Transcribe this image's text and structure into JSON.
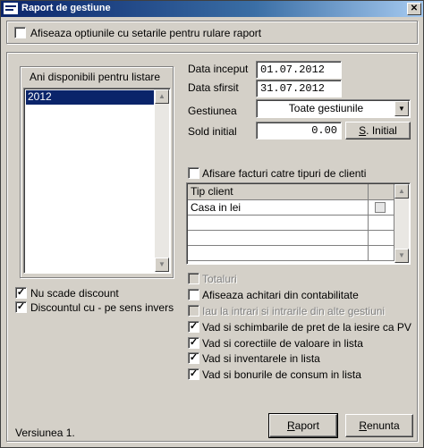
{
  "window": {
    "title": "Raport de gestiune",
    "close_glyph": "✕"
  },
  "top_option": {
    "label": "Afiseaza optiunile cu setarile pentru rulare raport",
    "checked": false
  },
  "years_panel": {
    "header": "Ani disponibili pentru listare",
    "items": [
      "2012"
    ],
    "selected": "2012"
  },
  "left_options": [
    {
      "label": "Nu scade discount",
      "checked": true
    },
    {
      "label": "Discountul cu - pe sens invers",
      "checked": true
    }
  ],
  "form": {
    "start_label": "Data inceput",
    "start_value": "01.07.2012",
    "end_label": "Data sfirsit",
    "end_value": "31.07.2012",
    "store_label": "Gestiunea",
    "store_value": "Toate gestiunile",
    "balance_label": "Sold initial",
    "balance_value": "0.00",
    "balance_button": {
      "accel": "S",
      "rest": ". Initial"
    }
  },
  "client_filter": {
    "label": "Afisare facturi catre tipuri de clienti",
    "checked": false,
    "column": "Tip client",
    "rows": [
      {
        "name": "Casa in lei",
        "checked": false
      }
    ]
  },
  "options": [
    {
      "label": "Totaluri",
      "checked": false,
      "enabled": false
    },
    {
      "label": "Afiseaza achitari din contabilitate",
      "checked": false,
      "enabled": true
    },
    {
      "label": "Iau la intrari si intrarile din alte gestiuni",
      "checked": false,
      "enabled": false
    },
    {
      "label": "Vad si schimbarile de pret de la iesire ca PV",
      "checked": true,
      "enabled": true
    },
    {
      "label": "Vad si corectiile de valoare in lista",
      "checked": true,
      "enabled": true
    },
    {
      "label": "Vad si inventarele in lista",
      "checked": true,
      "enabled": true
    },
    {
      "label": "Vad si bonurile de consum in lista",
      "checked": true,
      "enabled": true
    }
  ],
  "footer": {
    "version": "Versiunea 1.",
    "report_button": {
      "accel": "R",
      "rest": "aport"
    },
    "cancel_button": {
      "accel": "R",
      "pre": "",
      "rest": "enunta"
    }
  },
  "check_glyph": "✓",
  "arrow_down_glyph": "▼",
  "arrow_up_glyph": "▲"
}
